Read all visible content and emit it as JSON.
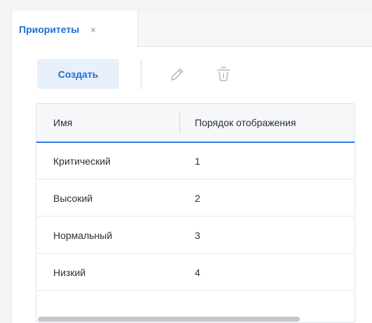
{
  "tab": {
    "label": "Приоритеты",
    "close_glyph": "×"
  },
  "toolbar": {
    "create_label": "Создать",
    "edit_icon": "pencil-icon",
    "delete_icon": "trash-icon"
  },
  "table": {
    "columns": [
      "Имя",
      "Порядок отображения"
    ],
    "rows": [
      {
        "name": "Критический",
        "order": "1"
      },
      {
        "name": "Высокий",
        "order": "2"
      },
      {
        "name": "Нормальный",
        "order": "3"
      },
      {
        "name": "Низкий",
        "order": "4"
      }
    ]
  },
  "colors": {
    "accent": "#1f6fd1",
    "header_underline": "#2f7be5",
    "button_bg": "#e8f0fb"
  }
}
